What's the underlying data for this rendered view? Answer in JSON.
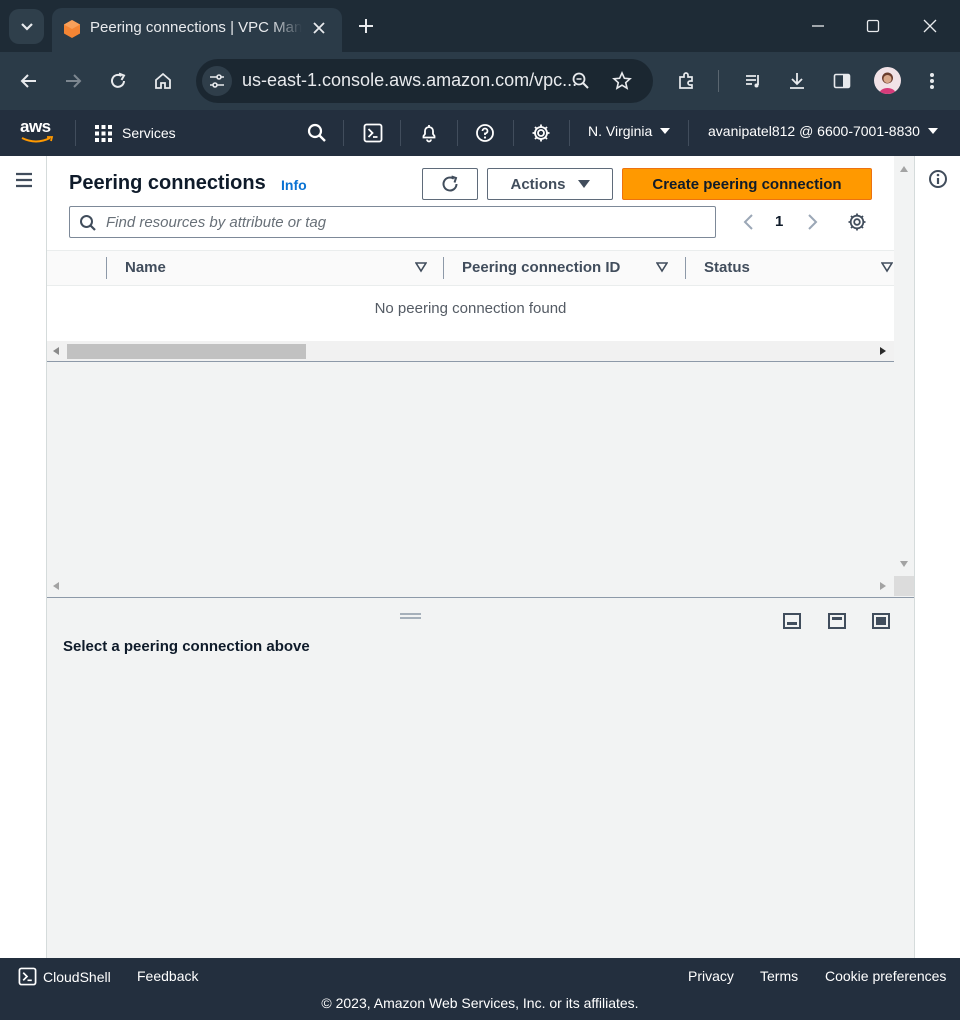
{
  "browser": {
    "tab_title": "Peering connections | VPC Management Console",
    "url": "us-east-1.console.aws.amazon.com/vpc..."
  },
  "aws_header": {
    "logo": "aws",
    "services_label": "Services",
    "region": "N. Virginia",
    "account": "avanipatel812 @ 6600-7001-8830"
  },
  "main": {
    "title": "Peering connections",
    "info_link": "Info",
    "actions_label": "Actions",
    "create_label": "Create peering connection",
    "search_placeholder": "Find resources by attribute or tag",
    "page_number": "1",
    "columns": [
      "Name",
      "Peering connection ID",
      "Status"
    ],
    "empty_message": "No peering connection found",
    "details_message": "Select a peering connection above"
  },
  "footer": {
    "cloudshell": "CloudShell",
    "feedback": "Feedback",
    "privacy": "Privacy",
    "terms": "Terms",
    "cookie_preferences": "Cookie preferences",
    "copyright": "© 2023, Amazon Web Services, Inc. or its affiliates."
  },
  "colors": {
    "primary_button": "#ff9900",
    "header_bg": "#232f3e",
    "info_link": "#0972d3"
  }
}
